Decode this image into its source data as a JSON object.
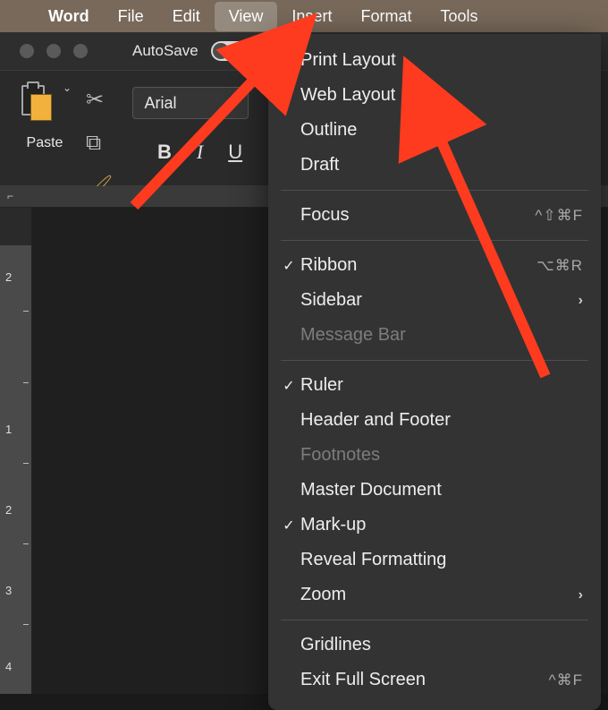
{
  "menubar": {
    "app": "Word",
    "items": [
      "File",
      "Edit",
      "View",
      "Insert",
      "Format",
      "Tools"
    ],
    "active_index": 2
  },
  "titlebar": {
    "autosave_label": "AutoSave"
  },
  "ribbon": {
    "paste_label": "Paste",
    "font_name": "Arial",
    "bold": "B",
    "italic": "I",
    "underline": "U"
  },
  "vruler": {
    "marks": [
      "2",
      "1",
      "2",
      "3",
      "4"
    ]
  },
  "menu": {
    "groups": [
      [
        {
          "label": "Print Layout",
          "checked": true
        },
        {
          "label": "Web Layout"
        },
        {
          "label": "Outline"
        },
        {
          "label": "Draft"
        }
      ],
      [
        {
          "label": "Focus",
          "shortcut": "^⇧⌘F"
        }
      ],
      [
        {
          "label": "Ribbon",
          "checked": true,
          "shortcut": "⌥⌘R"
        },
        {
          "label": "Sidebar",
          "submenu": true
        },
        {
          "label": "Message Bar",
          "disabled": true
        }
      ],
      [
        {
          "label": "Ruler",
          "checked": true
        },
        {
          "label": "Header and Footer"
        },
        {
          "label": "Footnotes",
          "disabled": true
        },
        {
          "label": "Master Document"
        },
        {
          "label": "Mark-up",
          "checked": true
        },
        {
          "label": "Reveal Formatting"
        },
        {
          "label": "Zoom",
          "submenu": true
        }
      ],
      [
        {
          "label": "Gridlines"
        },
        {
          "label": "Exit Full Screen",
          "shortcut": "^⌘F"
        }
      ]
    ]
  }
}
